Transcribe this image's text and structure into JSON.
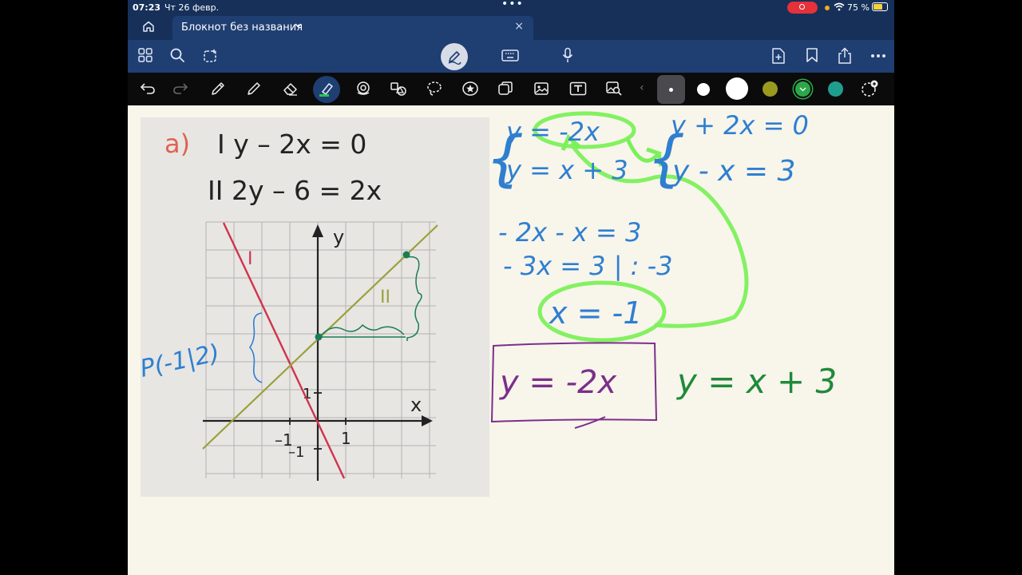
{
  "status": {
    "time": "07:23",
    "date": "Чт 26 февр.",
    "dots": "•••",
    "battery": "75 %"
  },
  "tab": {
    "title": "Блокнот без названия",
    "close": "×"
  },
  "icons": {
    "home": "home-icon",
    "grid": "grid-icon",
    "search": "search-icon",
    "lasso": "lasso-icon",
    "pen_mode": "pen-mode-icon",
    "keyboard": "keyboard-icon",
    "mic": "microphone-icon",
    "add_page": "add-page-icon",
    "bookmark": "bookmark-icon",
    "share": "share-icon",
    "more": "more-icon"
  },
  "colors": {
    "navy": "#16305a",
    "toolbar_blue": "#1f3e72",
    "ink_blue": "#2e7fd0",
    "ink_green_highlight": "#7cf05a",
    "ink_purple": "#7b2f8a",
    "ink_dark_green": "#1f8a3a",
    "swatch_olive": "#9a9a1e",
    "swatch_green": "#2ca84a",
    "swatch_teal": "#1f9e8e"
  },
  "photo": {
    "label": "a)",
    "eq1": "I  y – 2x = 0",
    "eq2": "II  2y – 6 = 2x",
    "axis_x": "x",
    "axis_y": "y",
    "line1": "I",
    "line2": "II",
    "tick_x_pos": "1",
    "tick_x_neg": "–1",
    "tick_y_pos": "1",
    "tick_y_neg": "–1"
  },
  "handwriting": {
    "point": "P(-1|2)",
    "sys1_eq1": "y = -2x",
    "sys1_eq2": "y = x + 3",
    "sys2_eq1": "y + 2x = 0",
    "sys2_eq2": "y - x = 3",
    "step1": "- 2x - x = 3",
    "step2": "- 3x = 3 | : -3",
    "result": "x = -1",
    "boxed": "y = -2x",
    "line2_eq": "y = x + 3"
  }
}
